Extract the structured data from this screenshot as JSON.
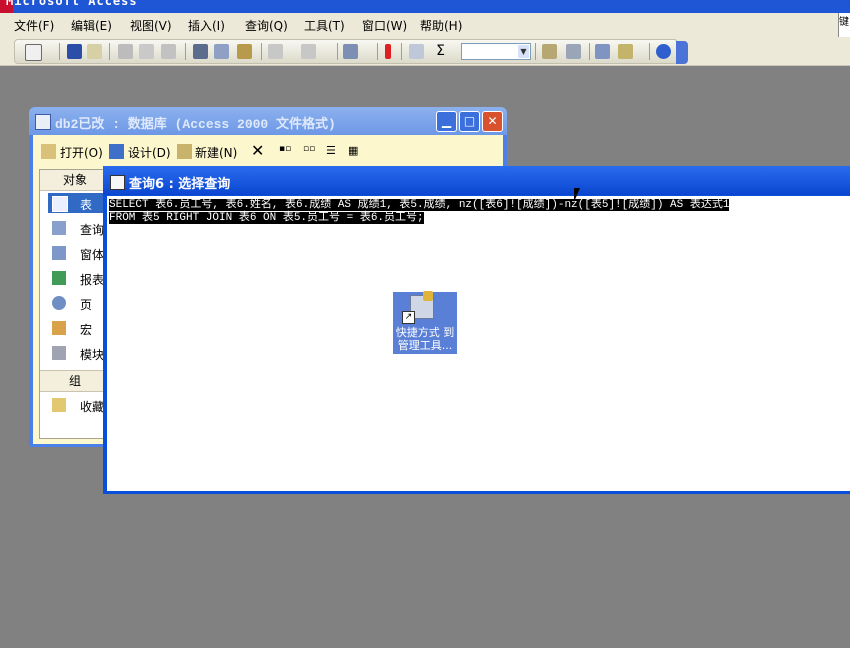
{
  "app": {
    "title": "Microsoft Access"
  },
  "menu": [
    {
      "label": "文件(F)"
    },
    {
      "label": "编辑(E)"
    },
    {
      "label": "视图(V)"
    },
    {
      "label": "插入(I)"
    },
    {
      "label": "查询(Q)"
    },
    {
      "label": "工具(T)"
    },
    {
      "label": "窗口(W)"
    },
    {
      "label": "帮助(H)"
    }
  ],
  "right_clip_text": "键",
  "toolbar": {
    "icons": [
      "view-icon",
      "save-icon",
      "file-search-icon",
      "print-icon",
      "print-preview-icon",
      "spelling-icon",
      "cut-icon",
      "copy-icon",
      "paste-icon",
      "undo-icon",
      "redo-icon",
      "query-type-icon",
      "run-icon",
      "show-table-icon",
      "totals-icon",
      "properties-icon",
      "build-icon",
      "database-window-icon",
      "new-object-icon",
      "help-icon"
    ],
    "combo_value": "",
    "colors": {
      "accent": "#316ac5",
      "run": "#e02020"
    }
  },
  "db_window": {
    "title": "db2已改 : 数据库 (Access 2000 文件格式)",
    "tools": {
      "open_label": "打开(O)",
      "design_label": "设计(D)",
      "new_label": "新建(N)"
    },
    "panel": {
      "objects_header": "对象",
      "groups_header": "组",
      "items": [
        {
          "label": "表",
          "icon": "table-icon"
        },
        {
          "label": "查询",
          "icon": "query-icon"
        },
        {
          "label": "窗体",
          "icon": "form-icon"
        },
        {
          "label": "报表",
          "icon": "report-icon"
        },
        {
          "label": "页",
          "icon": "page-icon"
        },
        {
          "label": "宏",
          "icon": "macro-icon"
        },
        {
          "label": "模块",
          "icon": "module-icon"
        }
      ],
      "favorites_label": "收藏",
      "selected": "表"
    }
  },
  "query_window": {
    "title": "查询6 : 选择查询",
    "sql_line1": "SELECT 表6.员工号, 表6.姓名, 表6.成绩 AS 成绩1, 表5.成绩, nz([表6]![成绩])-nz([表5]![成绩]) AS 表达式1",
    "sql_line2": "FROM 表5 RIGHT JOIN 表6 ON 表5.员工号 = 表6.员工号;"
  },
  "shortcut": {
    "caption_line1": "快捷方式 到",
    "caption_line2": "管理工具..."
  }
}
